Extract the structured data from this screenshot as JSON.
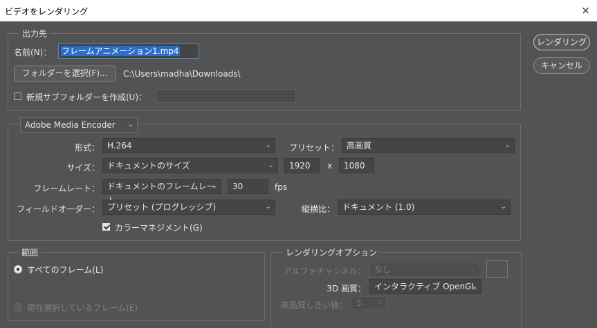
{
  "window": {
    "title": "ビデオをレンダリング",
    "close_icon": "×"
  },
  "output": {
    "legend": "出力先",
    "name_label": "名前(N)：",
    "name_value": "フレームアニメーション1.mp4",
    "folder_button": "フォルダーを選択(F)...",
    "folder_path": "C:\\Users\\madha\\Downloads\\",
    "subfolder_label": "新規サブフォルダーを作成(U)："
  },
  "actions": {
    "render": "レンダリング",
    "cancel": "キャンセル"
  },
  "encoder": {
    "engine": "Adobe Media Encoder",
    "format_label": "形式：",
    "format_value": "H.264",
    "preset_label": "プリセット：",
    "preset_value": "高画質",
    "size_label": "サイズ：",
    "size_value": "ドキュメントのサイズ",
    "width": "1920",
    "times": "x",
    "height": "1080",
    "framerate_label": "フレームレート：",
    "framerate_value": "ドキュメントのフレームレート",
    "fps_value": "30",
    "fps_unit": "fps",
    "field_order_label": "フィールドオーダー：",
    "field_order_value": "プリセット (プログレッシブ)",
    "aspect_label": "縦横比：",
    "aspect_value": "ドキュメント (1.0)",
    "color_management": "カラーマネジメント(G)",
    "color_management_checked": true
  },
  "range": {
    "legend": "範囲",
    "all_frames": "すべてのフレーム(L)",
    "selected_frames": "現在選択しているフレーム(E)"
  },
  "render_options": {
    "legend": "レンダリングオプション",
    "alpha_label": "アルファチャンネル：",
    "alpha_value": "なし",
    "3d_quality_label": "3D 画質：",
    "3d_quality_value": "インタラクティブ OpenGL",
    "hq_threshold_label": "高品質しきい値：",
    "hq_threshold_value": "5"
  },
  "icons": {
    "chevron": "⌄"
  }
}
